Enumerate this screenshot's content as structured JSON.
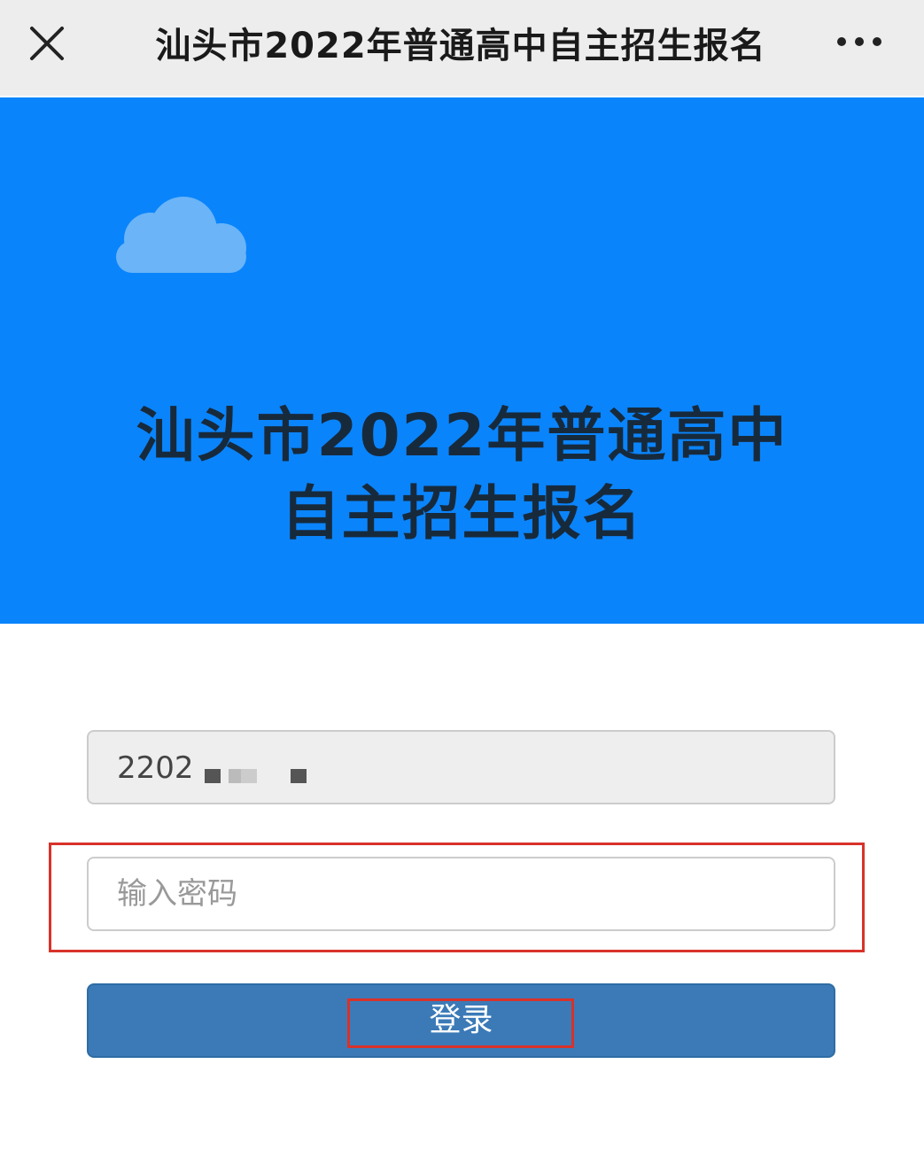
{
  "navbar": {
    "title": "汕头市2022年普通高中自主招生报名",
    "close_icon": "close-icon",
    "more_icon": "more-icon"
  },
  "banner": {
    "background": "#0a84fb",
    "cloud_icon": "cloud-icon",
    "title_line1": "汕头市2022年普通高中",
    "title_line2": "自主招生报名"
  },
  "form": {
    "account_value": "2202",
    "password_placeholder": "输入密码",
    "login_label": "登录",
    "highlight_color": "#d8322a",
    "button_color": "#3b7ab7"
  }
}
